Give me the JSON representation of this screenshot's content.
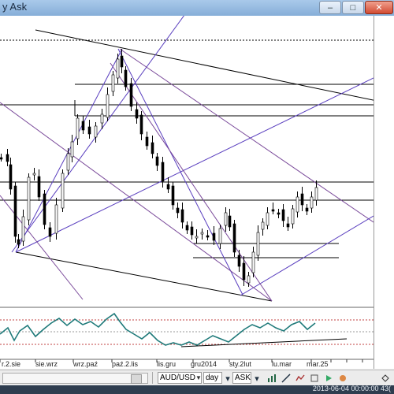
{
  "window": {
    "title": "y Ask",
    "minimize": "–",
    "maximize": "□",
    "close": "✕"
  },
  "xaxis": {
    "labels": [
      "r.2.sie",
      "sie.wrz",
      "wrz.paź",
      "paź.2.lis",
      "lis.gru",
      "gru2014",
      "sty.2lut",
      "lu.mar",
      "mar.25"
    ]
  },
  "toolbar": {
    "symbol": "AUD/USD",
    "period": "day",
    "price": "ASK"
  },
  "status": {
    "datetime": "2013-06-04 00:00:00  43("
  },
  "icons": [
    "scroll-left-icon",
    "scroll-right-icon",
    "chart-settings-icon",
    "line-tool-icon",
    "indicator-icon",
    "delete-icon",
    "expand-icon"
  ]
}
